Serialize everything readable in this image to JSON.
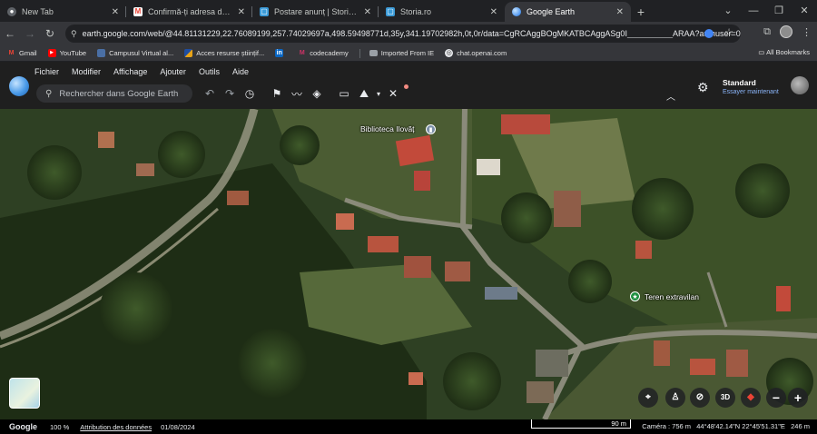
{
  "tabs": [
    {
      "title": "New Tab",
      "icon": "chrome-icon",
      "active": false
    },
    {
      "title": "Confirmă-ți adresa de e-mail -",
      "icon": "gmail-icon",
      "active": false
    },
    {
      "title": "Postare anunț | Storia.ro",
      "icon": "storia-icon",
      "active": false
    },
    {
      "title": "Storia.ro",
      "icon": "storia-icon",
      "active": false
    },
    {
      "title": "Google Earth",
      "icon": "earth-icon",
      "active": true
    }
  ],
  "new_tab": "+",
  "address": {
    "url": "earth.google.com/web/@44.81131229,22.76089199,257.74029697a,498.59498771d,35y,341.19702982h,0t,0r/data=CgRCAggBOgMKATBCAggASg0I__________ARAA?authuser=0"
  },
  "bookmarks": [
    {
      "label": "Gmail",
      "icon": "gmail-icon",
      "color": "#ea4335"
    },
    {
      "label": "YouTube",
      "icon": "youtube-icon",
      "color": "#ff0000"
    },
    {
      "label": "Campusul Virtual al...",
      "icon": "campus-icon",
      "color": "#4a6fa5"
    },
    {
      "label": "Acces resurse științif...",
      "icon": "research-icon",
      "color": "#e8a317"
    },
    {
      "label": "",
      "icon": "linkedin-icon",
      "color": "#0a66c2"
    },
    {
      "label": "codecademy",
      "icon": "codecademy-icon",
      "color": "#cc3366"
    },
    {
      "label": "Imported From IE",
      "icon": "folder-icon",
      "color": "#9aa0a6"
    },
    {
      "label": "chat.openai.com",
      "icon": "openai-icon",
      "color": "#74aa9c"
    }
  ],
  "all_bookmarks": "All Bookmarks",
  "menu": [
    "Fichier",
    "Modifier",
    "Affichage",
    "Ajouter",
    "Outils",
    "Aide"
  ],
  "search": {
    "placeholder": "Rechercher dans Google Earth"
  },
  "profile": {
    "plan": "Standard",
    "cta": "Essayer maintenant"
  },
  "map": {
    "labels": [
      {
        "text": "Biblioteca Ilovăț",
        "icon": "library-pin-icon"
      },
      {
        "text": "Teren extravilan",
        "icon": "star-pin-icon"
      }
    ],
    "controls": [
      "recenter",
      "pegman",
      "hide-3d",
      "3D",
      "compass",
      "zoom-out",
      "zoom-in"
    ],
    "control_3d": "3D"
  },
  "status": {
    "google": "Google",
    "zoom": "100 %",
    "attribution": "Attribution des données",
    "date": "01/08/2024",
    "scale": "90 m",
    "camera": "Caméra : 756 m",
    "coords": "44°48'42.14\"N 22°45'51.31\"E",
    "altitude": "246 m"
  },
  "colors": {
    "accent": "#8ab4f8",
    "tab_active": "#35363a",
    "chrome_bg": "#202124"
  }
}
